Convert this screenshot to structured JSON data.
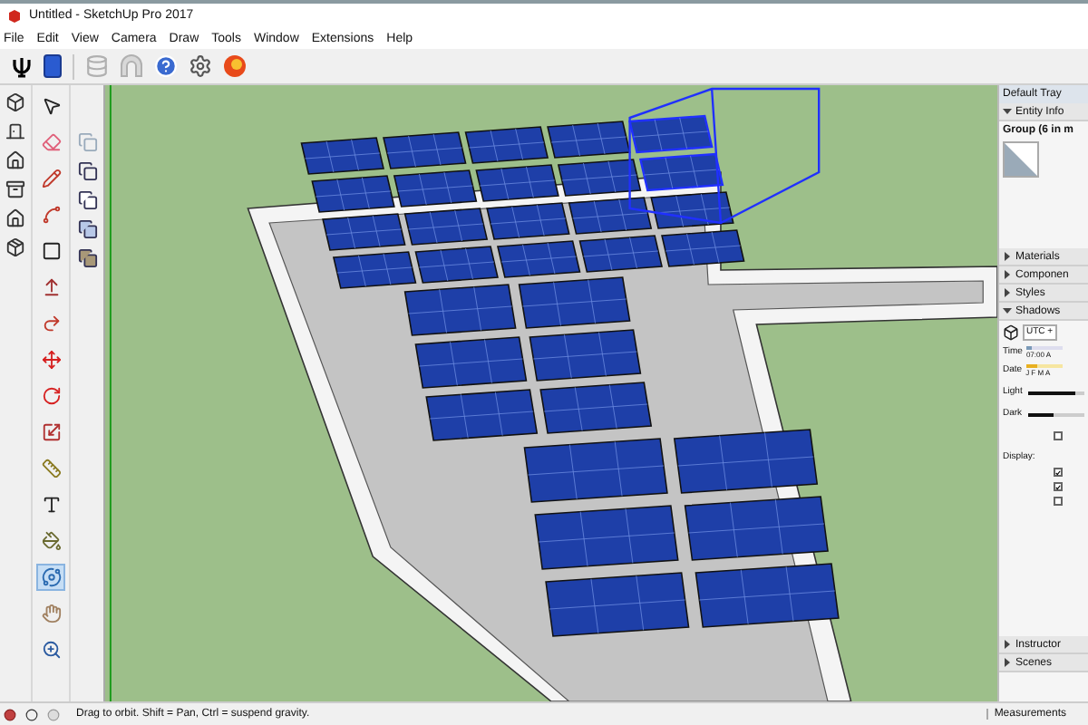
{
  "window": {
    "title": "Untitled - SketchUp Pro 2017"
  },
  "menu": [
    "File",
    "Edit",
    "View",
    "Camera",
    "Draw",
    "Tools",
    "Window",
    "Extensions",
    "Help"
  ],
  "toolbar": [
    {
      "kind": "psi"
    },
    {
      "kind": "panel"
    },
    {
      "kind": "sep"
    },
    {
      "kind": "db"
    },
    {
      "kind": "arch"
    },
    {
      "kind": "help"
    },
    {
      "kind": "gear"
    },
    {
      "kind": "ruby"
    }
  ],
  "views": [
    {
      "kind": "iso"
    },
    {
      "kind": "top"
    },
    {
      "kind": "front"
    },
    {
      "kind": "right"
    },
    {
      "kind": "back"
    },
    {
      "kind": "left"
    }
  ],
  "tools": [
    {
      "kind": "select",
      "selected": false
    },
    {
      "kind": "eraser",
      "selected": false
    },
    {
      "kind": "pencil",
      "selected": false
    },
    {
      "kind": "arc",
      "selected": false
    },
    {
      "kind": "rect",
      "selected": false
    },
    {
      "kind": "pushpull",
      "selected": false
    },
    {
      "kind": "followme",
      "selected": false
    },
    {
      "kind": "move",
      "selected": false
    },
    {
      "kind": "rotate",
      "selected": false
    },
    {
      "kind": "scale",
      "selected": false
    },
    {
      "kind": "tape",
      "selected": false
    },
    {
      "kind": "text",
      "selected": false
    },
    {
      "kind": "paint",
      "selected": false
    },
    {
      "kind": "orbit",
      "selected": true
    },
    {
      "kind": "pan",
      "selected": false
    },
    {
      "kind": "zoom",
      "selected": false
    }
  ],
  "styles": [
    {
      "kind": "xray"
    },
    {
      "kind": "wire"
    },
    {
      "kind": "hidden"
    },
    {
      "kind": "shaded"
    },
    {
      "kind": "textured"
    }
  ],
  "tray": {
    "title": "Default Tray",
    "entity_info": {
      "label": "Entity Info",
      "expanded": true,
      "group": "Group (6 in m"
    },
    "collapsed_top": [
      {
        "label": "Materials",
        "expanded": false
      },
      {
        "label": "Componen",
        "expanded": false
      },
      {
        "label": "Styles",
        "expanded": false
      }
    ],
    "shadows": {
      "label": "Shadows",
      "expanded": true,
      "utc": "UTC +",
      "time_label": "Time",
      "time_value": "07:00 A",
      "time_slider": {
        "level": 0.15
      },
      "date_label": "Date",
      "months": "J F M A",
      "date_slider": {
        "level": 0.3
      },
      "light": "Light",
      "light_slider": {
        "level": 0.85
      },
      "dark": "Dark",
      "dark_slider": {
        "level": 0.45
      },
      "display": "Display:",
      "checkboxes": [
        {
          "checked": false
        },
        {
          "checked": true
        },
        {
          "checked": true
        },
        {
          "checked": false
        }
      ]
    },
    "collapsed_bottom": [
      {
        "label": "Instructor",
        "expanded": false
      },
      {
        "label": "Scenes",
        "expanded": false
      }
    ]
  },
  "status_bar": {
    "hint": "Drag to orbit. Shift = Pan, Ctrl = suspend gravity.",
    "measurements": "Measurements"
  }
}
